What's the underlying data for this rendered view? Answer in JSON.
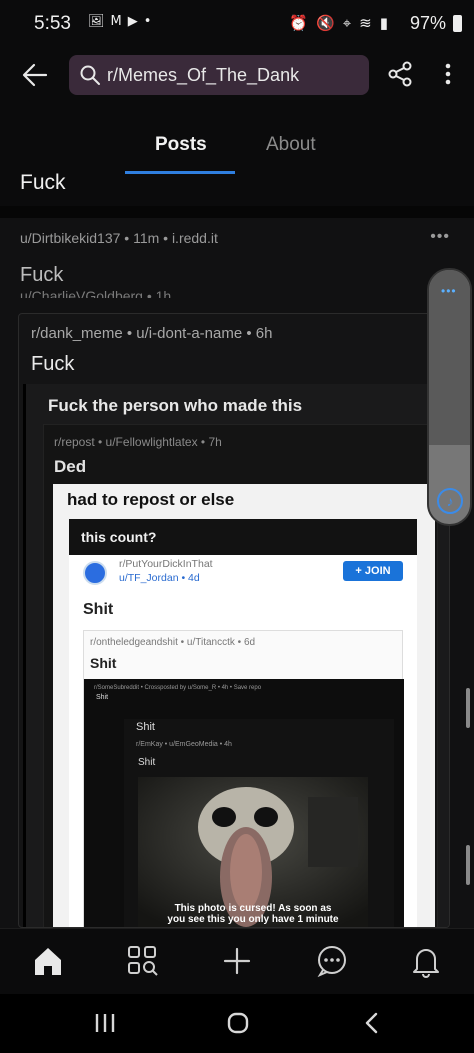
{
  "status_bar": {
    "time": "5:53",
    "battery": "97%",
    "left_icons": [
      "image-icon",
      "gmail-icon",
      "youtube-icon",
      "dot-icon"
    ],
    "right_icons": [
      "alarm-icon",
      "mute-icon",
      "location-icon",
      "wifi-icon",
      "signal-icon"
    ]
  },
  "header": {
    "search_text": "r/Memes_Of_The_Dank"
  },
  "tabs": [
    {
      "label": "Posts",
      "active": true
    },
    {
      "label": "About",
      "active": false
    }
  ],
  "sticky_title": "Fuck",
  "post": {
    "meta": "u/Dirtbikekid137 • 11m • i.redd.it",
    "more": "•••",
    "title": "Fuck",
    "ghost_meta": "u/CharlieVGoldberg • 1h"
  },
  "meme": {
    "layer1": {
      "meta": "r/dank_meme • u/i-dont-a-name • 6h",
      "title": "Fuck"
    },
    "layer2": {
      "title": "Fuck the person who made this"
    },
    "layer3": {
      "meta": "r/repost • u/Fellowlightlatex • 7h",
      "title": "Ded"
    },
    "layer4": {
      "title": "had to repost or else"
    },
    "layer5": {
      "title": "this count?"
    },
    "layer6": {
      "sub": "r/PutYourDickInThat",
      "user": "u/TF_Jordan • 4d",
      "join": "+ JOIN",
      "title": "Shit"
    },
    "layer7": {
      "meta": "r/ontheledgeandshit • u/Titancctk • 6d",
      "title": "Shit"
    },
    "layer8": {
      "meta": "r/SomeSubreddit • Crossposted by u/Some_R • 4h • Save repo",
      "shit1": "Shit",
      "shit2": "Shit",
      "meta2": "r/EmKay • u/EmGeoMedia • 4h",
      "shit3": "Shit",
      "caption_line1": "This photo is cursed! As soon as",
      "caption_line2": "you see this you only have 1 minute"
    }
  },
  "colors": {
    "accent": "#2f7fe0",
    "background": "#0b0b0c",
    "search_bg": "#3a2a3a"
  }
}
